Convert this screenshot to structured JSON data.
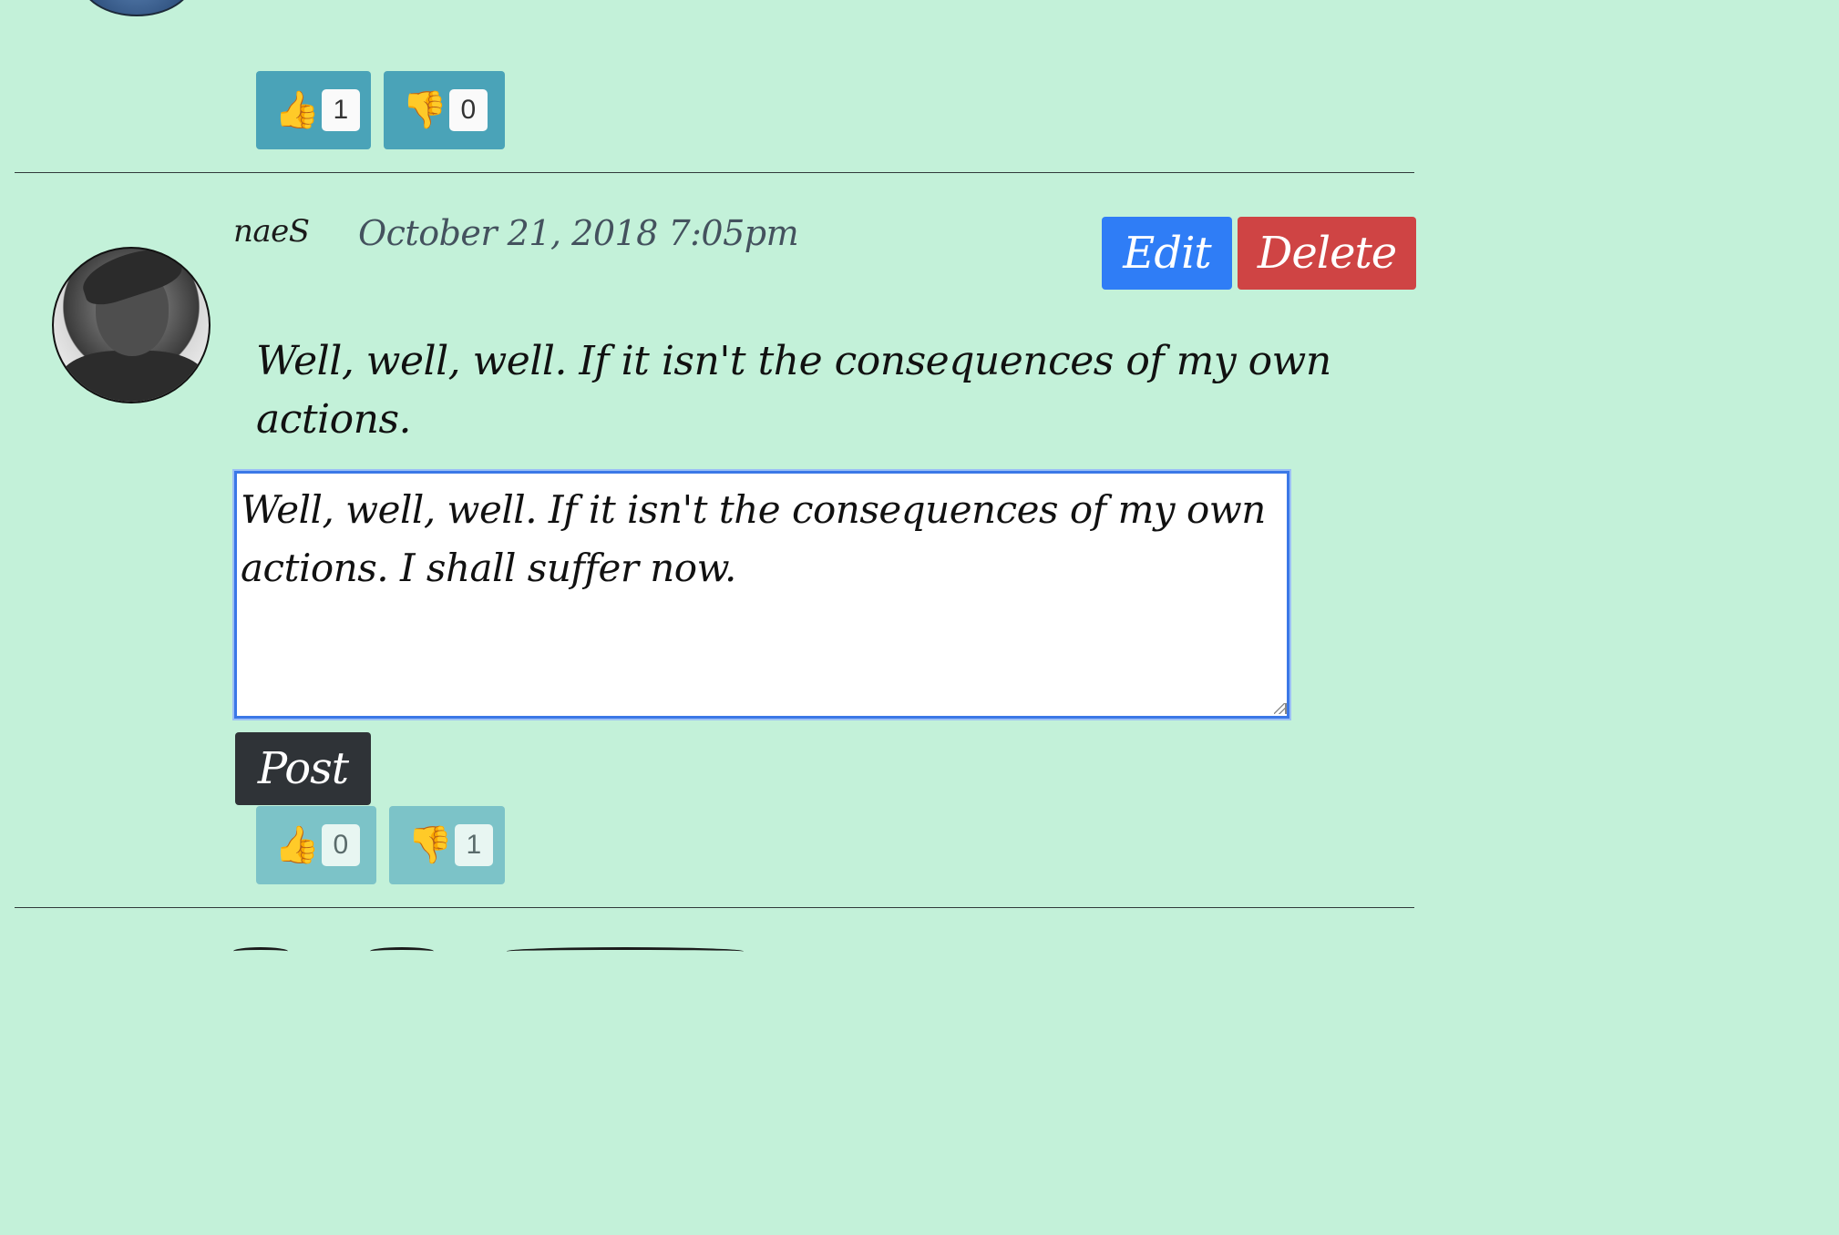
{
  "previous_comment": {
    "likes": {
      "icon": "thumbs-up-icon",
      "glyph": "👍",
      "count": "1"
    },
    "dislikes": {
      "icon": "thumbs-down-icon",
      "glyph": "👎",
      "count": "0"
    }
  },
  "comment": {
    "author": "naeS",
    "date": "October 21, 2018 7:05pm",
    "text": "Well, well, well. If it isn't the consequences of my own actions.",
    "edit_value": "Well, well, well. If it isn't the consequences of my own actions. I shall suffer now.",
    "actions": {
      "edit_label": "Edit",
      "delete_label": "Delete",
      "post_label": "Post"
    },
    "likes": {
      "icon": "thumbs-up-icon",
      "glyph": "👍",
      "count": "0"
    },
    "dislikes": {
      "icon": "thumbs-down-icon",
      "glyph": "👎",
      "count": "1"
    }
  },
  "colors": {
    "background": "#c3f1d9",
    "vote_button": "#4aa3b8",
    "edit_button": "#2f7df6",
    "delete_button": "#cf4444",
    "post_button": "#2f3337"
  }
}
